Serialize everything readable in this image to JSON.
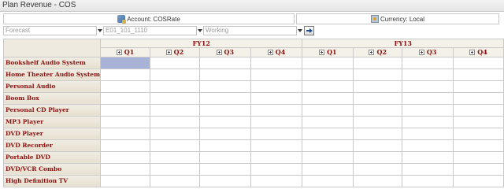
{
  "window": {
    "title": "Plan Revenue - COS"
  },
  "pov": {
    "account_label": "Account: COSRate",
    "account_icon": "account-dimension-icon",
    "currency_label": "Currency: Local",
    "currency_icon": "currency-dimension-icon"
  },
  "selectors": {
    "scenario": "Forecast",
    "entity": "E01_101_1110",
    "version": "Working"
  },
  "grid": {
    "years": [
      "FY12",
      "FY13"
    ],
    "quarters": [
      "Q1",
      "Q2",
      "Q3",
      "Q4",
      "Q1",
      "Q2",
      "Q3",
      "Q4"
    ],
    "rows": [
      "Bookshelf Audio System",
      "Home Theater Audio System",
      "Personal Audio",
      "Boom Box",
      "Personal CD Player",
      "MP3 Player",
      "DVD Player",
      "DVD Recorder",
      "Portable DVD",
      "DVD/VCR Combo",
      "High Definition TV"
    ],
    "selected_cell_color": "#a9b3d8",
    "header_text_color": "#8b1010"
  }
}
